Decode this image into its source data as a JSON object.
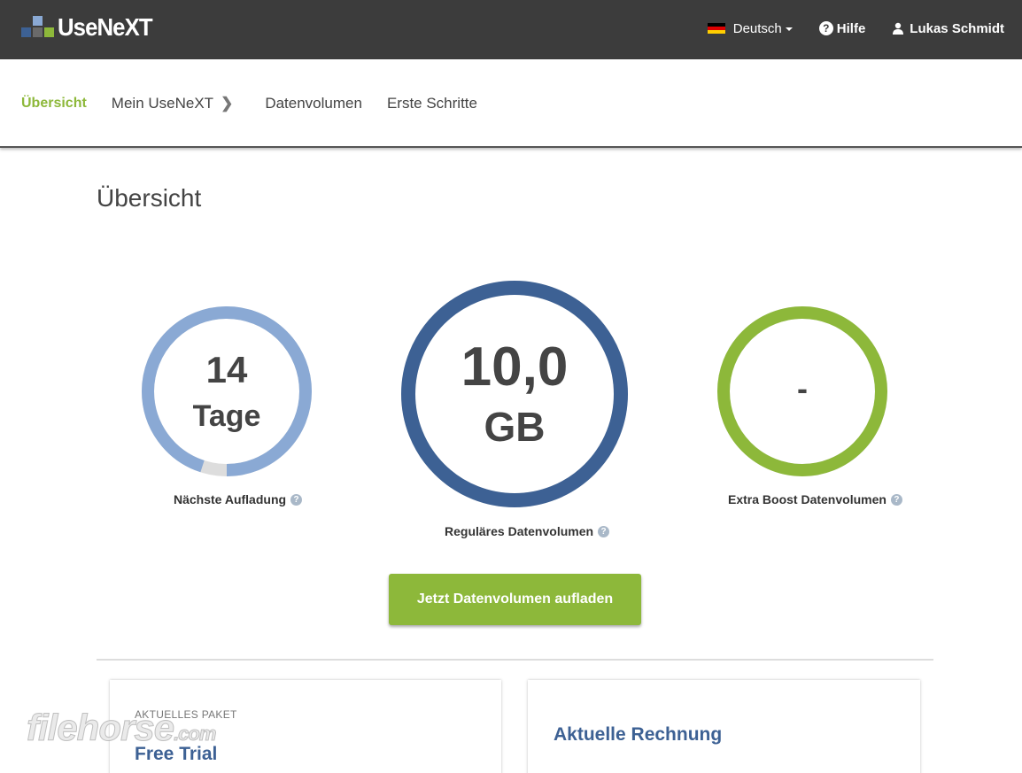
{
  "brand": {
    "name": "UseNeXT",
    "colors": {
      "blue_dark": "#3d6194",
      "blue_light": "#8aa9d4",
      "green": "#8db83a"
    }
  },
  "topbar": {
    "language": "Deutsch",
    "help": "Hilfe",
    "user": "Lukas Schmidt"
  },
  "subnav": {
    "items": [
      {
        "label": "Übersicht",
        "active": true
      },
      {
        "label": "Mein UseNeXT",
        "has_chevron": true
      },
      {
        "label": "Datenvolumen"
      },
      {
        "label": "Erste Schritte"
      }
    ]
  },
  "main": {
    "title": "Übersicht",
    "gauges": [
      {
        "value": "14",
        "unit": "Tage",
        "label": "Nächste Aufladung",
        "color": "#8aa9d4",
        "remaining_color": "#dddddd",
        "fill_fraction": 0.95
      },
      {
        "value": "10,0",
        "unit": "GB",
        "label": "Reguläres Datenvolumen",
        "color": "#3d6194",
        "fill_fraction": 1.0
      },
      {
        "value": "-",
        "unit": "",
        "label": "Extra Boost Datenvolumen",
        "color": "#8db83a",
        "fill_fraction": 1.0
      }
    ],
    "cta": "Jetzt Datenvolumen aufladen"
  },
  "cards": [
    {
      "small": "AKTUELLES PAKET",
      "title": "Free Trial"
    },
    {
      "small": "",
      "title": "Aktuelle Rechnung"
    }
  ],
  "watermark": {
    "text": "filehorse",
    "suffix": ".com"
  }
}
